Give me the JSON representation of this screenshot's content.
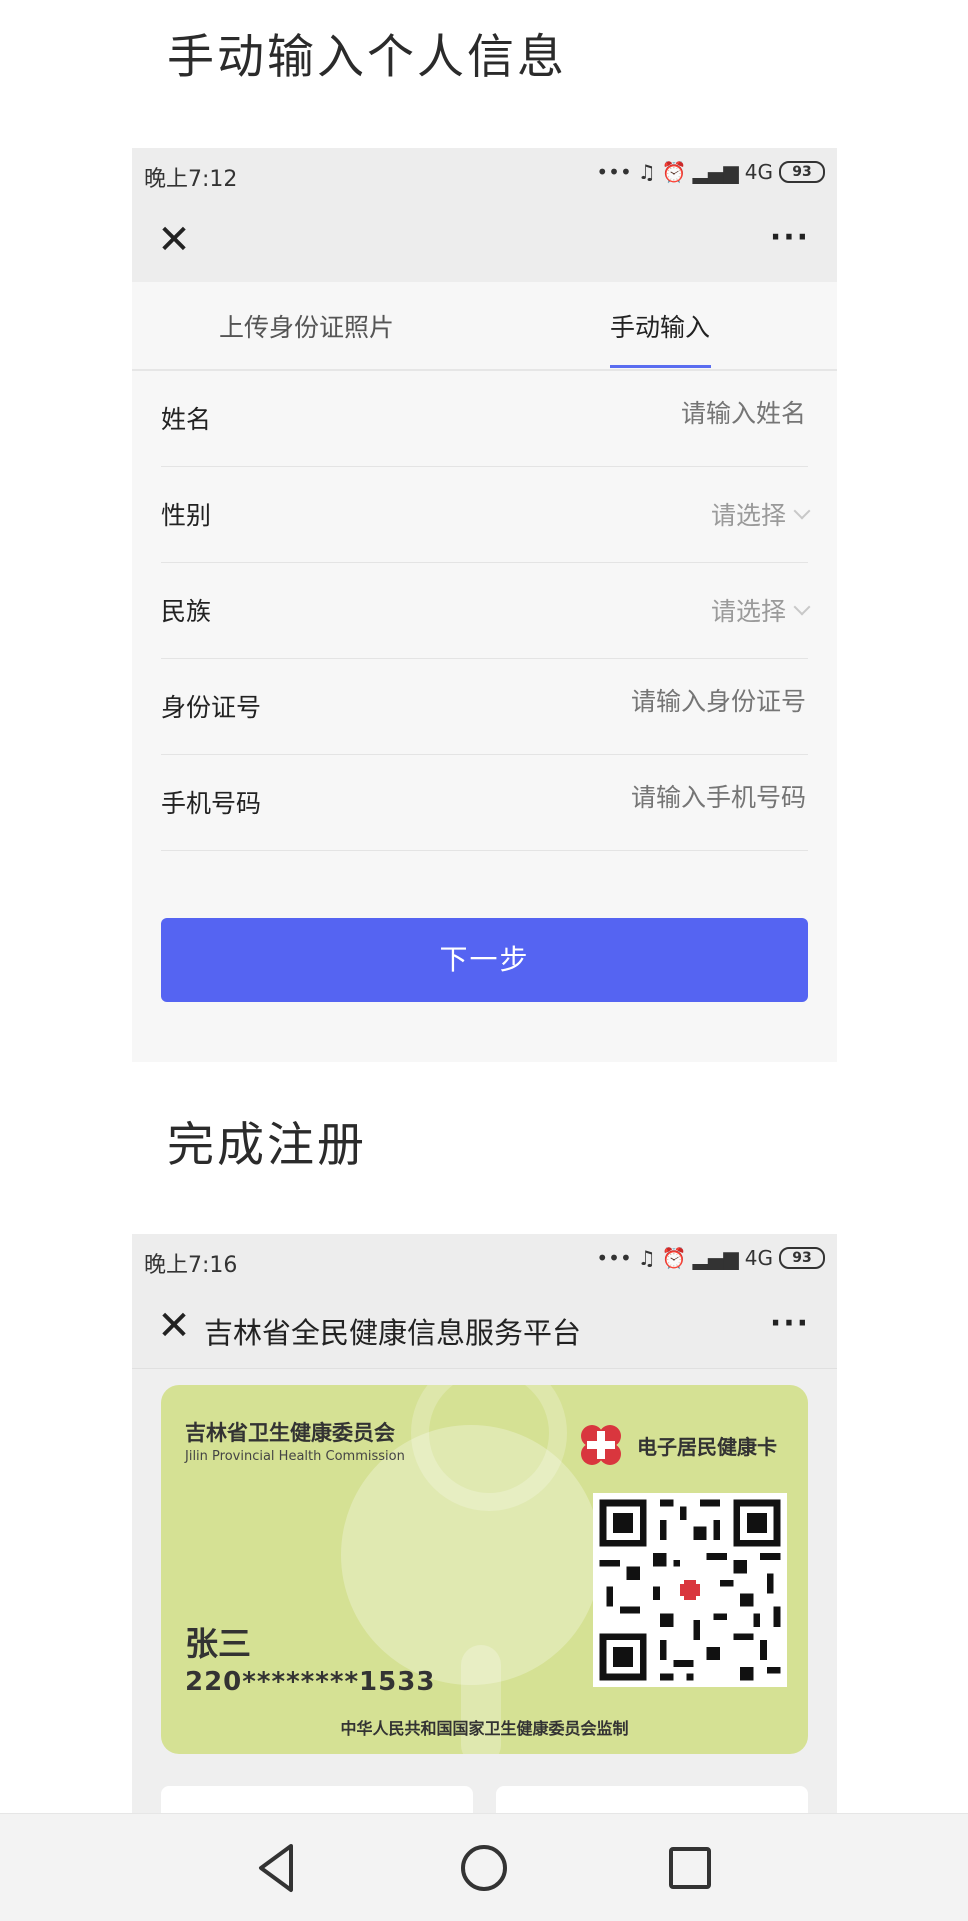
{
  "section1": {
    "title": "手动输入个人信息"
  },
  "section2": {
    "title": "完成注册"
  },
  "phone1": {
    "status": {
      "time": "晚上7:12",
      "network": "4G",
      "battery": "93"
    },
    "tabs": {
      "upload_label": "上传身份证照片",
      "manual_label": "手动输入"
    },
    "form": {
      "rows": [
        {
          "label": "姓名",
          "placeholder": "请输入姓名",
          "kind": "text"
        },
        {
          "label": "性别",
          "value": "请选择",
          "kind": "select"
        },
        {
          "label": "民族",
          "value": "请选择",
          "kind": "select"
        },
        {
          "label": "身份证号",
          "placeholder": "请输入身份证号",
          "kind": "text"
        },
        {
          "label": "手机号码",
          "placeholder": "请输入手机号码",
          "kind": "text"
        }
      ]
    },
    "next_button_label": "下一步",
    "colors": {
      "accent": "#5564f2"
    }
  },
  "phone2": {
    "status": {
      "time": "晚上7:16",
      "network": "4G",
      "battery": "93"
    },
    "nav_title": "吉林省全民健康信息服务平台",
    "card": {
      "org_cn": "吉林省卫生健康委员会",
      "org_en": "Jilin Provincial Health Commission",
      "brand": "电子居民健康卡",
      "name": "张三",
      "id_masked": "220********1533",
      "footer": "中华人民共和国国家卫生健康委员会监制",
      "background_color": "#d5e194"
    }
  },
  "icons": {
    "close": "close-icon",
    "more": "more-icon",
    "back": "back-triangle-icon",
    "home": "home-circle-icon",
    "recents": "recents-square-icon"
  }
}
